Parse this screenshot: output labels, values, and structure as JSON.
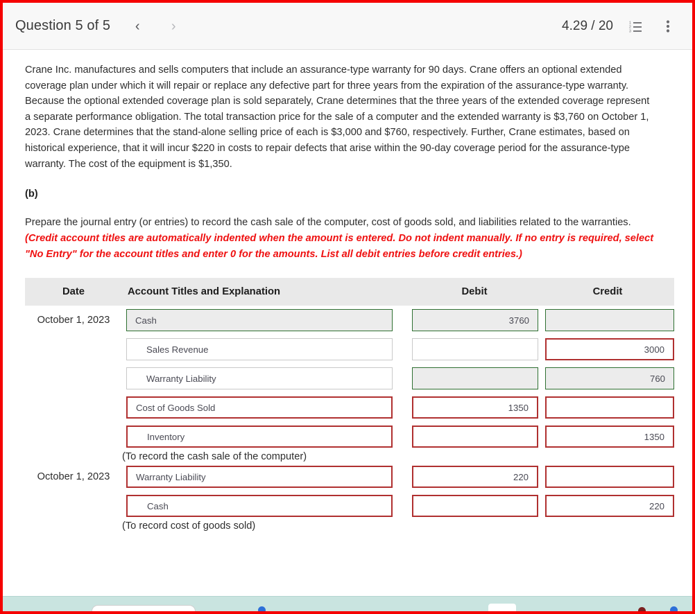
{
  "header": {
    "question_title": "Question 5 of 5",
    "prev_label": "‹",
    "next_label": "›",
    "score": "4.29 / 20",
    "list_icon": "numbered-list-icon",
    "menu_icon": "more-vertical-icon"
  },
  "problem": {
    "text": "Crane Inc. manufactures and sells computers that include an assurance-type warranty for 90 days. Crane offers an optional extended coverage plan under which it will repair or replace any defective part for three years from the expiration of the assurance-type warranty. Because the optional extended coverage plan is sold separately, Crane determines that the three years of the extended coverage represent a separate performance obligation. The total transaction price for the sale of a computer and the extended warranty is $3,760 on October 1, 2023. Crane determines that the stand-alone selling price of each is $3,000 and $760, respectively. Further, Crane estimates, based on historical experience, that it will incur $220 in costs to repair defects that arise within the 90-day coverage period for the assurance-type warranty. The cost of the equipment is $1,350."
  },
  "part_label": "(b)",
  "requirement": {
    "lead": "Prepare the journal entry (or entries) to record the cash sale of the computer, cost of goods sold, and liabilities related to the warranties. ",
    "instruction": "(Credit account titles are automatically indented when the amount is entered. Do not indent manually. If no entry is required, select \"No Entry\" for the account titles and enter 0 for the amounts. List all debit entries before credit entries.)"
  },
  "table": {
    "headers": {
      "date": "Date",
      "account": "Account Titles and Explanation",
      "debit": "Debit",
      "credit": "Credit"
    },
    "rows": [
      {
        "type": "entry",
        "date": "October 1, 2023",
        "account": "Cash",
        "account_state": "ok",
        "account_indent": false,
        "debit": "3760",
        "debit_state": "ok",
        "credit": "",
        "credit_state": "ok"
      },
      {
        "type": "entry",
        "date": "",
        "account": "Sales Revenue",
        "account_state": "plain",
        "account_indent": true,
        "debit": "",
        "debit_state": "plain",
        "credit": "3000",
        "credit_state": "wrong"
      },
      {
        "type": "entry",
        "date": "",
        "account": "Warranty Liability",
        "account_state": "plain",
        "account_indent": true,
        "debit": "",
        "debit_state": "ok",
        "credit": "760",
        "credit_state": "ok"
      },
      {
        "type": "entry",
        "date": "",
        "account": "Cost of Goods Sold",
        "account_state": "wrong",
        "account_indent": false,
        "debit": "1350",
        "debit_state": "wrong",
        "credit": "",
        "credit_state": "wrong"
      },
      {
        "type": "entry",
        "date": "",
        "account": "Inventory",
        "account_state": "wrong",
        "account_indent": true,
        "debit": "",
        "debit_state": "wrong",
        "credit": "1350",
        "credit_state": "wrong"
      },
      {
        "type": "note",
        "note": "(To record the cash sale of the computer)"
      },
      {
        "type": "entry",
        "date": "October 1, 2023",
        "account": "Warranty Liability",
        "account_state": "wrong",
        "account_indent": false,
        "debit": "220",
        "debit_state": "wrong",
        "credit": "",
        "credit_state": "wrong"
      },
      {
        "type": "entry",
        "date": "",
        "account": "Cash",
        "account_state": "wrong",
        "account_indent": true,
        "debit": "",
        "debit_state": "wrong",
        "credit": "220",
        "credit_state": "wrong"
      },
      {
        "type": "note",
        "note": "(To record cost of goods sold)"
      }
    ]
  },
  "colors": {
    "page_border": "#f50000",
    "correct_border": "#2e7031",
    "incorrect_border": "#b03030",
    "instruction_red": "#ef1111",
    "header_bg": "#f8f8f8",
    "table_header_bg": "#e9e9e9",
    "bottom_strip": "#c9e4e0"
  }
}
